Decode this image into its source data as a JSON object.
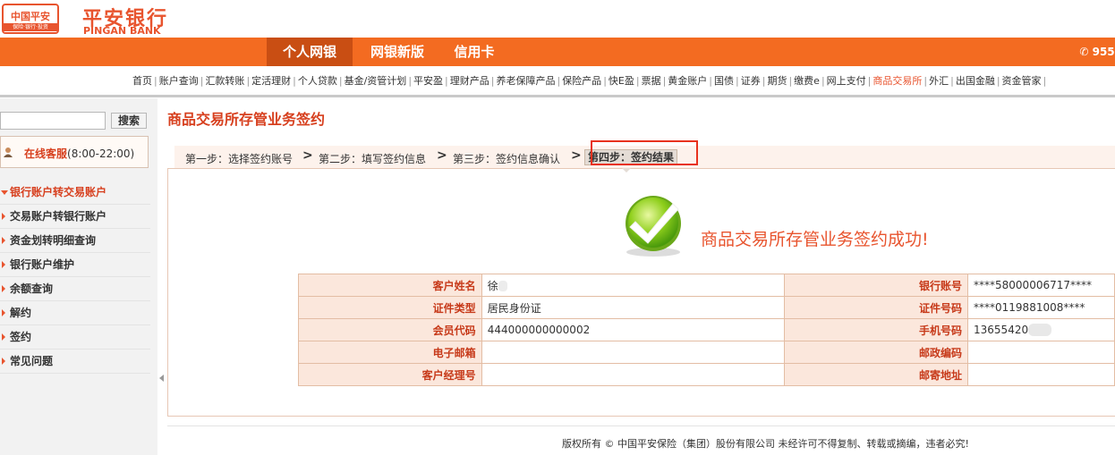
{
  "header": {
    "logo_text": "中国平安",
    "logo_sub": "保险·银行·投资",
    "brand_cn": "平安银行",
    "brand_en": "PINGAN BANK"
  },
  "nav": {
    "personal": "个人网银",
    "new": "网银新版",
    "credit": "信用卡",
    "phone": "955"
  },
  "menu": [
    "首页",
    "账户查询",
    "汇款转账",
    "定活理财",
    "个人贷款",
    "基金/资管计划",
    "平安盈",
    "理财产品",
    "养老保障产品",
    "保险产品",
    "快E盈",
    "票据",
    "黄金账户",
    "国债",
    "证券",
    "期货",
    "缴费e",
    "网上支付",
    "商品交易所",
    "外汇",
    "出国金融",
    "资金管家"
  ],
  "menu_active": "商品交易所",
  "search": {
    "button": "搜索",
    "value": ""
  },
  "service": {
    "label": "在线客服",
    "hours": "(8:00-22:00)"
  },
  "sidebar": [
    "银行账户转交易账户",
    "交易账户转银行账户",
    "资金划转明细查询",
    "银行账户维护",
    "余额查询",
    "解约",
    "签约",
    "常见问题"
  ],
  "page_title": "商品交易所存管业务签约",
  "steps": {
    "s1": "第一步：选择签约账号",
    "s2": "第二步：填写签约信息",
    "s3": "第三步：签约信息确认",
    "s4": "第四步：签约结果",
    "arrow": ">"
  },
  "success_message": "商品交易所存管业务签约成功!",
  "table": {
    "name_label": "客户姓名",
    "name_value": "徐",
    "account_label": "银行账号",
    "account_value": "****58000006717****",
    "idtype_label": "证件类型",
    "idtype_value": "居民身份证",
    "idno_label": "证件号码",
    "idno_value": "****0119881008****",
    "member_label": "会员代码",
    "member_value": "444000000000002",
    "phone_label": "手机号码",
    "phone_value": "13655420",
    "email_label": "电子邮箱",
    "email_value": "",
    "zip_label": "邮政编码",
    "zip_value": "",
    "manager_label": "客户经理号",
    "manager_value": "",
    "address_label": "邮寄地址",
    "address_value": ""
  },
  "footer": "版权所有 © 中国平安保险（集团）股份有限公司 未经许可不得复制、转载或摘编，违者必究!"
}
